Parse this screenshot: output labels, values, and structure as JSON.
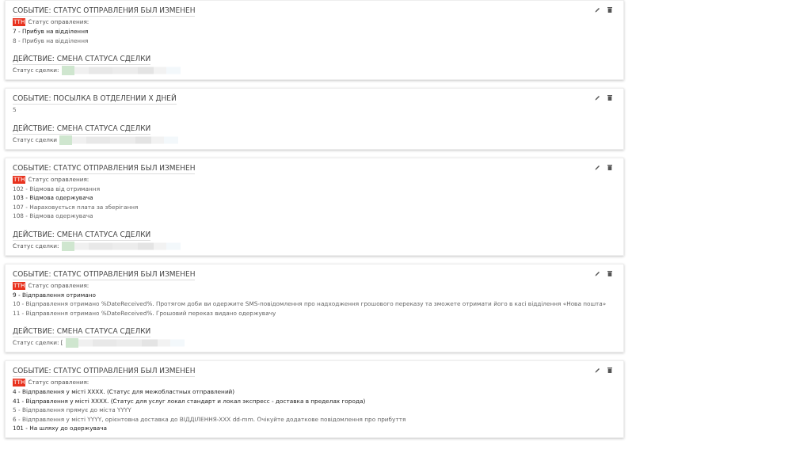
{
  "rules": [
    {
      "event": {
        "title": "СОБЫТИЕ: СТАТУС ОТПРАВЛЕНИЯ БЫЛ ИЗМЕНЕН",
        "tag": "ТТН",
        "label": "Статус оправления:",
        "lines": [
          {
            "text": "7 - Прибув на відділення",
            "highlighted": true
          },
          {
            "text": "8 - Прибув на відділення",
            "highlighted": false
          }
        ]
      },
      "action": {
        "title": "ДЕЙСТВИЕ: СМЕНА СТАТУСА СДЕЛКИ",
        "label": "Статус сделки:"
      }
    },
    {
      "event": {
        "title": "СОБЫТИЕ: ПОСЫЛКА В ОТДЕЛЕНИИ Х ДНЕЙ",
        "value": "5"
      },
      "action": {
        "title": "ДЕЙСТВИЕ: СМЕНА СТАТУСА СДЕЛКИ",
        "label": "Статус сделки"
      }
    },
    {
      "event": {
        "title": "СОБЫТИЕ: СТАТУС ОТПРАВЛЕНИЯ БЫЛ ИЗМЕНЕН",
        "tag": "ТТН",
        "label": "Статус оправления:",
        "lines": [
          {
            "text": "102 - Відмова від отримання",
            "highlighted": false
          },
          {
            "text": "103 - Відмова одержувача",
            "highlighted": true
          },
          {
            "text": "107 - Нараховується плата за зберігання",
            "highlighted": false
          },
          {
            "text": "108 - Відмова одержувача",
            "highlighted": false
          }
        ]
      },
      "action": {
        "title": "ДЕЙСТВИЕ: СМЕНА СТАТУСА СДЕЛКИ",
        "label": "Статус сделки:"
      }
    },
    {
      "event": {
        "title": "СОБЫТИЕ: СТАТУС ОТПРАВЛЕНИЯ БЫЛ ИЗМЕНЕН",
        "tag": "ТТН",
        "label": "Статус оправления:",
        "lines": [
          {
            "text": "9 - Відправлення отримано",
            "highlighted": true
          },
          {
            "text": "10 - Відправлення отримано %DateReceived%. Протягом доби ви одержите SMS-повідомлення про надходження грошового переказу та зможете отримати його в касі відділення «Нова пошта»",
            "highlighted": false
          },
          {
            "text": "11 - Відправлення отримано %DateReceived%. Грошовий переказ видано одержувачу",
            "highlighted": false
          }
        ]
      },
      "action": {
        "title": "ДЕЙСТВИЕ: СМЕНА СТАТУСА СДЕЛКИ",
        "label": "Статус сделки: ["
      }
    },
    {
      "event": {
        "title": "СОБЫТИЕ: СТАТУС ОТПРАВЛЕНИЯ БЫЛ ИЗМЕНЕН",
        "tag": "ТТН",
        "label": "Статус оправления:",
        "lines": [
          {
            "text": "4 - Відправлення у місті ХХХХ. (Статус для межобластных отправлений)",
            "highlighted": true
          },
          {
            "text": "41 - Відправлення у місті ХХХХ. (Статус для услуг локал стандарт и локал экспресс - доставка в пределах города)",
            "highlighted": true
          },
          {
            "text": "5 - Відправлення прямує до міста YYYY",
            "highlighted": false
          },
          {
            "text": "6 - Відправлення у місті YYYY, орієнтовна доставка до ВІДДІЛЕННЯ-XXX dd-mm. Очікуйте додаткове повідомлення про прибуття",
            "highlighted": false
          },
          {
            "text": "101 - На шляху до одержувача",
            "highlighted": true
          }
        ]
      }
    }
  ]
}
